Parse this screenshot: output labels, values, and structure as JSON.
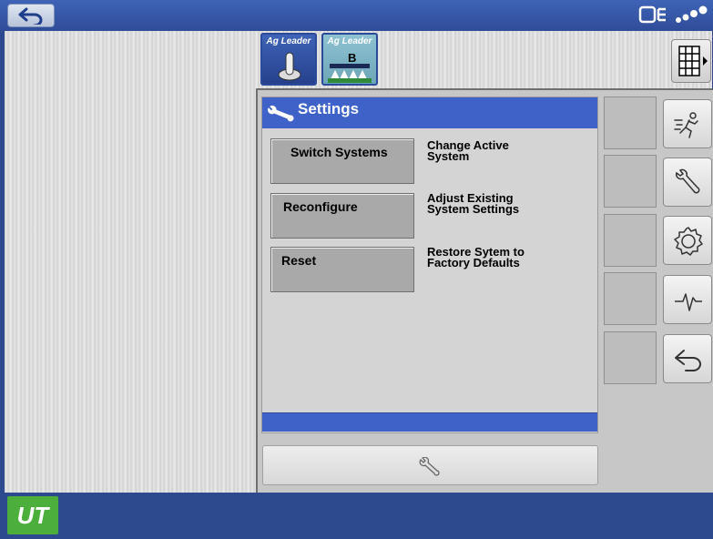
{
  "topbar": {
    "back_icon": "undo-arrow-icon",
    "status_icons": [
      "display-connection-icon",
      "signal-strength-icon"
    ]
  },
  "tabs": [
    {
      "label": "Ag Leader",
      "icon": "joystick-icon"
    },
    {
      "label": "Ag Leader",
      "icon": "boom-sprayer-icon",
      "badge": "B"
    }
  ],
  "grid_button": {
    "icon": "grid-menu-icon"
  },
  "dialog": {
    "title": "Settings",
    "title_icon": "wrench-icon",
    "options": [
      {
        "button": "Switch Systems",
        "description": "Change Active\nSystem"
      },
      {
        "button": "Reconfigure",
        "description": "Adjust Existing\nSystem Settings"
      },
      {
        "button": "Reset",
        "description": "Restore Sytem to\nFactory Defaults"
      }
    ]
  },
  "settings_bar": {
    "icon": "wrench-icon"
  },
  "side_buttons": [
    {
      "icon": "running-person-icon"
    },
    {
      "icon": "wrench-icon"
    },
    {
      "icon": "gear-icon"
    },
    {
      "icon": "pulse-waveform-icon"
    },
    {
      "icon": "back-arrow-icon"
    }
  ],
  "bottombar": {
    "logo": "UT"
  },
  "colors": {
    "title_blue": "#3e62c8",
    "bar_blue": "#2d4a8e",
    "logo_green": "#4caf3c"
  }
}
